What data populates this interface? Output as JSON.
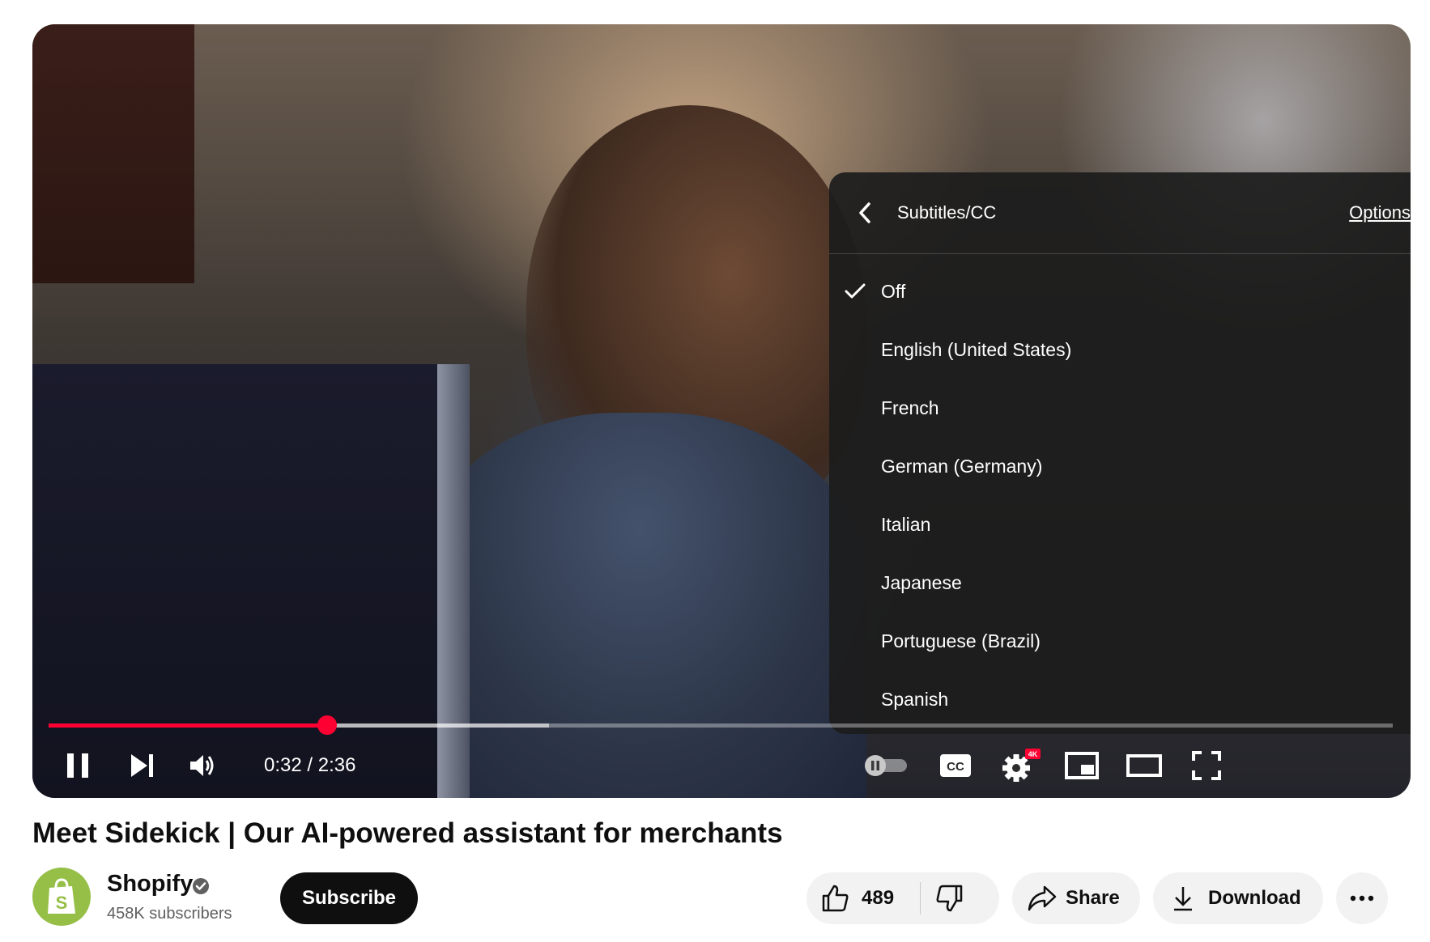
{
  "video": {
    "title": "Meet Sidekick | Our AI-powered assistant for merchants",
    "current_time": "0:32",
    "duration": "2:36",
    "played_fraction": 0.207,
    "buffered_fraction": 0.372
  },
  "player": {
    "quality_badge": "4K"
  },
  "subtitle_menu": {
    "title": "Subtitles/CC",
    "options_link": "Options",
    "items": [
      {
        "label": "Off",
        "selected": true
      },
      {
        "label": "English (United States)",
        "selected": false
      },
      {
        "label": "French",
        "selected": false
      },
      {
        "label": "German (Germany)",
        "selected": false
      },
      {
        "label": "Italian",
        "selected": false
      },
      {
        "label": "Japanese",
        "selected": false
      },
      {
        "label": "Portuguese (Brazil)",
        "selected": false
      },
      {
        "label": "Spanish",
        "selected": false
      }
    ]
  },
  "channel": {
    "name": "Shopify",
    "subscribers": "458K subscribers",
    "subscribe_label": "Subscribe"
  },
  "actions": {
    "like_count": "489",
    "share_label": "Share",
    "download_label": "Download"
  },
  "colors": {
    "progress_red": "#ff0033",
    "shopify_green": "#95bf47"
  }
}
